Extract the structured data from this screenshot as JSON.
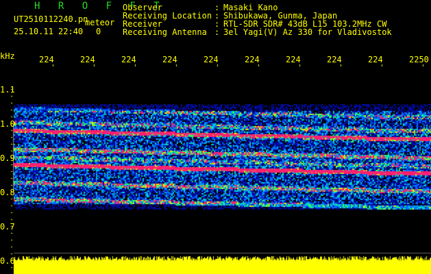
{
  "header": {
    "title": "H R O F F T",
    "filename": "UT2510112240.pn",
    "mode": "meteor",
    "datetime": "25.10.11 22:40",
    "count": "0",
    "fields": [
      {
        "label": "Observer",
        "value": "Masaki Kano"
      },
      {
        "label": "Receiving Location",
        "value": "Shibukawa, Gunma, Japan"
      },
      {
        "label": "Receiver",
        "value": "RTL-SDR SDR# 43dB L15 103.2MHz CW"
      },
      {
        "label": "Receiving Antenna",
        "value": "3el Yagi(V) Az 330 for Vladivostok"
      }
    ]
  },
  "axis": {
    "y_unit": "kHz",
    "y_ticks": [
      "1.1",
      "1.0",
      "0.9",
      "0.8",
      "0.7",
      "0.6"
    ],
    "x_ticks": [
      "2241",
      "2242",
      "2243",
      "2244",
      "2245",
      "2246",
      "2247",
      "2248",
      "2249",
      "2250"
    ]
  },
  "colors": {
    "text": "#ffff00",
    "title": "#22dd22",
    "signal": "#ff2060",
    "noise": "#0010a0"
  }
}
